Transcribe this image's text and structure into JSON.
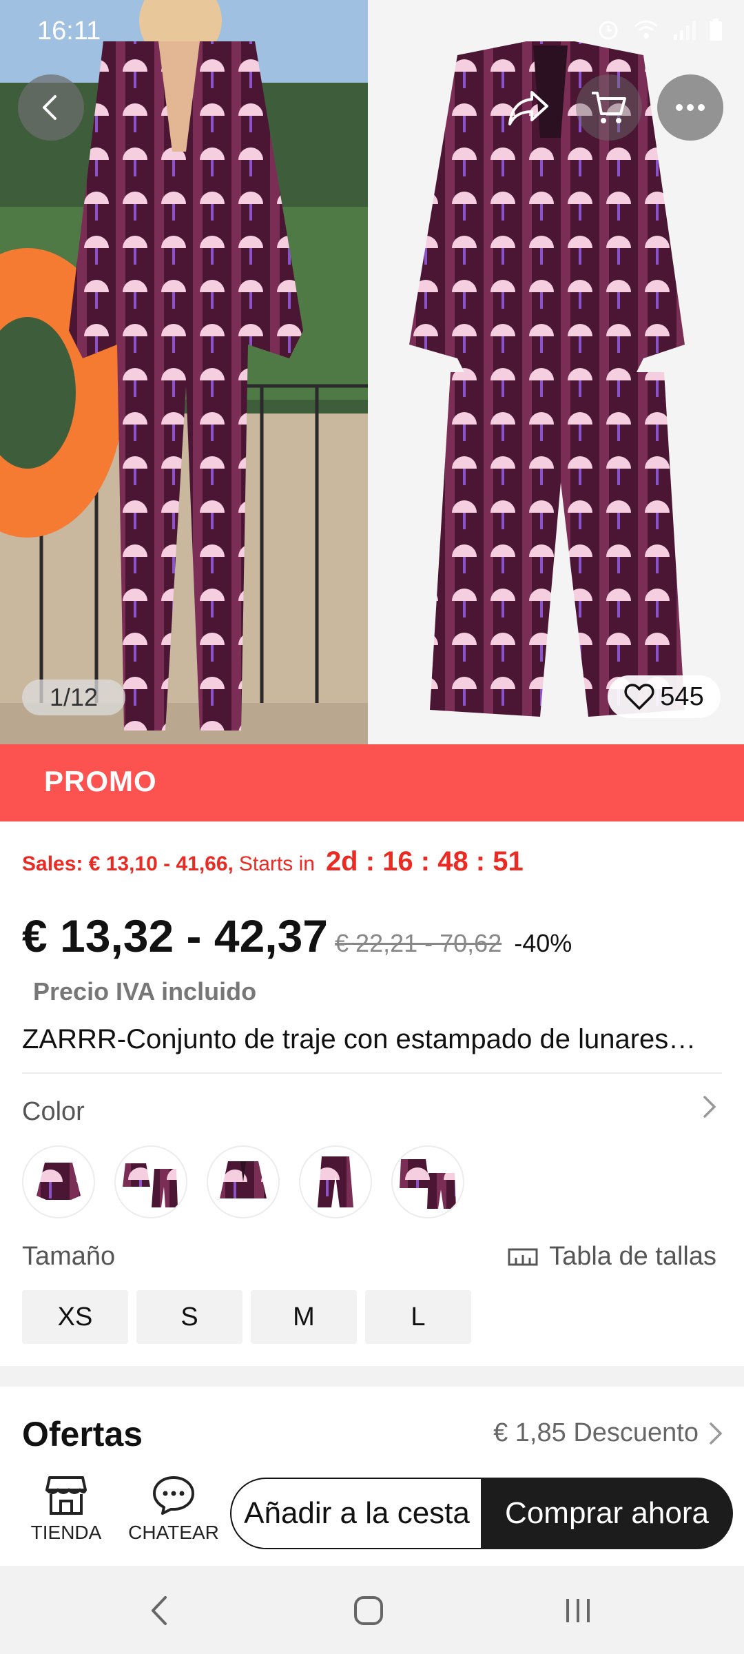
{
  "status_bar": {
    "time": "16:11",
    "icons": [
      "alarm-icon",
      "wifi-icon",
      "signal-icon",
      "battery-icon"
    ]
  },
  "gallery": {
    "counter": "1/12",
    "likes": "545",
    "icons": [
      "back-arrow-icon",
      "share-icon",
      "cart-icon",
      "more-icon",
      "heart-icon"
    ]
  },
  "promo": {
    "label": "PROMO",
    "sales_text": "Sales: € 13,10 - 41,66,",
    "starts_text": "Starts in",
    "countdown": "2d : 16 : 48 : 51"
  },
  "price": {
    "current": "€ 13,32 - 42,37",
    "original": "€ 22,21 - 70,62",
    "discount": "-40%",
    "vat_note": "Precio IVA incluido"
  },
  "product": {
    "title": "ZARRR-Conjunto de traje con estampado de lunares…"
  },
  "color": {
    "label": "Color",
    "swatches": [
      "blazer",
      "blazer-and-trousers",
      "blazer-front",
      "trousers",
      "set"
    ]
  },
  "size": {
    "label": "Tamaño",
    "chart_label": "Tabla de tallas",
    "options": [
      "XS",
      "S",
      "M",
      "L"
    ]
  },
  "offers": {
    "title": "Ofertas",
    "value": "€ 1,85 Descuento"
  },
  "actions": {
    "store_label": "TIENDA",
    "chat_label": "CHATEAR",
    "add_to_cart": "Añadir a la cesta",
    "buy_now": "Comprar ahora"
  },
  "colors": {
    "promo_red": "#fd5350",
    "sale_red": "#ea2b23",
    "buy_button": "#1c1c1c",
    "pattern_dark": "#5a1f3f",
    "pattern_light": "#f3c6d8"
  }
}
